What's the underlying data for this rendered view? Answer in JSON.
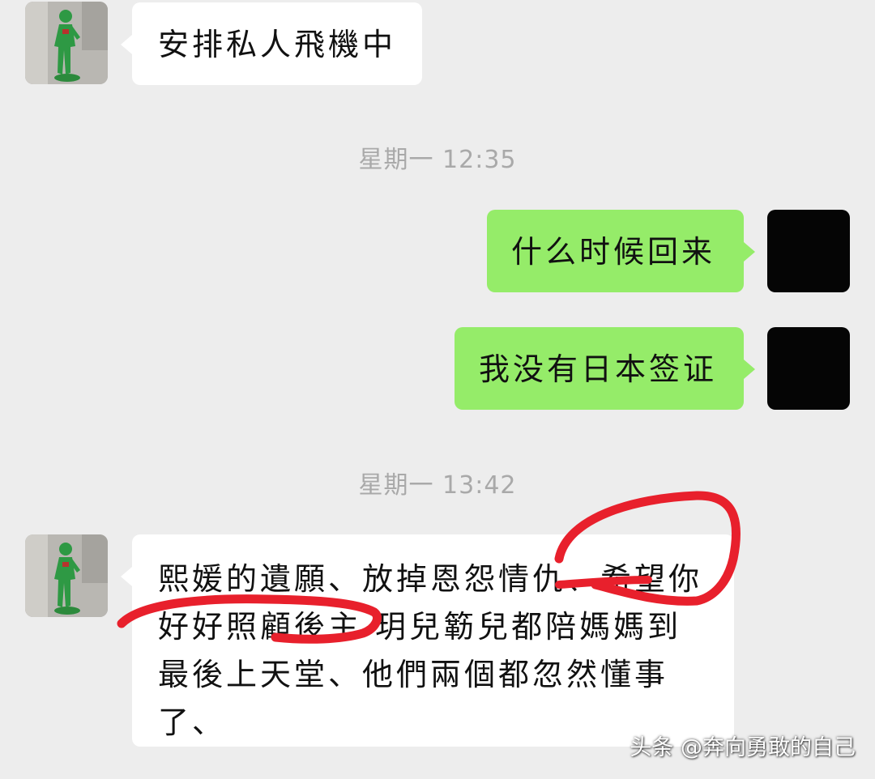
{
  "colors": {
    "background": "#ededed",
    "incoming_bubble": "#ffffff",
    "outgoing_bubble": "#95ec69",
    "timestamp": "#a9a9a9",
    "marker": "#e8202c"
  },
  "messages": [
    {
      "side": "incoming",
      "text": "安排私人飛機中"
    },
    {
      "side": "outgoing",
      "text": "什么时候回来"
    },
    {
      "side": "outgoing",
      "text": "我没有日本签证"
    },
    {
      "side": "incoming",
      "lines": [
        "熙媛的遺願、放掉恩怨情仇、希望你",
        "好好照顧後主 玥兒簕兒都陪媽媽到",
        "最後上天堂、他們兩個都忽然懂事",
        "了、"
      ]
    }
  ],
  "timestamps": [
    "星期一 12:35",
    "星期一 13:42"
  ],
  "avatars": {
    "other": "green-figure-avatar",
    "me": "black-avatar"
  },
  "watermark": "头条 @奔向勇敢的自己"
}
